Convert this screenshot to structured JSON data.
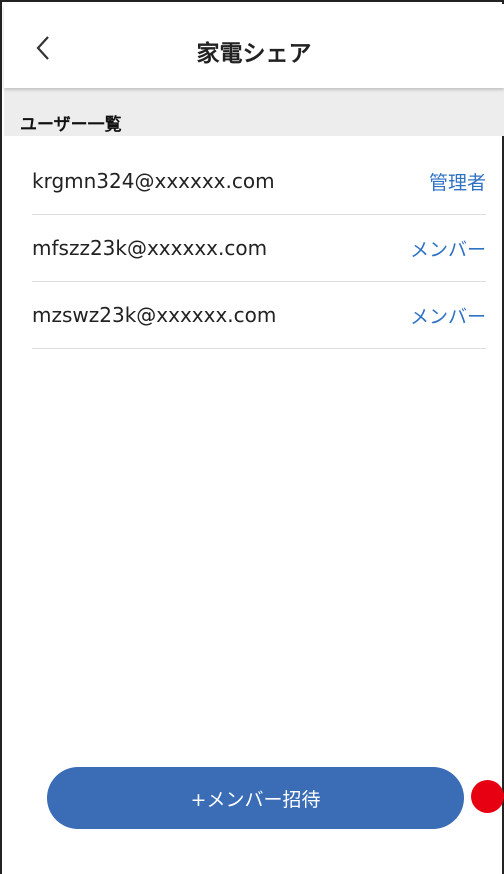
{
  "header": {
    "title": "家電シェア",
    "back_icon": "chevron-left-icon"
  },
  "section": {
    "label": "ユーザー一覧"
  },
  "users": [
    {
      "email": "krgmn324@xxxxxx.com",
      "role": "管理者"
    },
    {
      "email": "mfszz23k@xxxxxx.com",
      "role": "メンバー"
    },
    {
      "email": "mzswz23k@xxxxxx.com",
      "role": "メンバー"
    }
  ],
  "invite_button": {
    "label": "+メンバー招待"
  },
  "colors": {
    "accent": "#3a6db5",
    "link": "#2f72c4",
    "marker": "#e60012"
  }
}
